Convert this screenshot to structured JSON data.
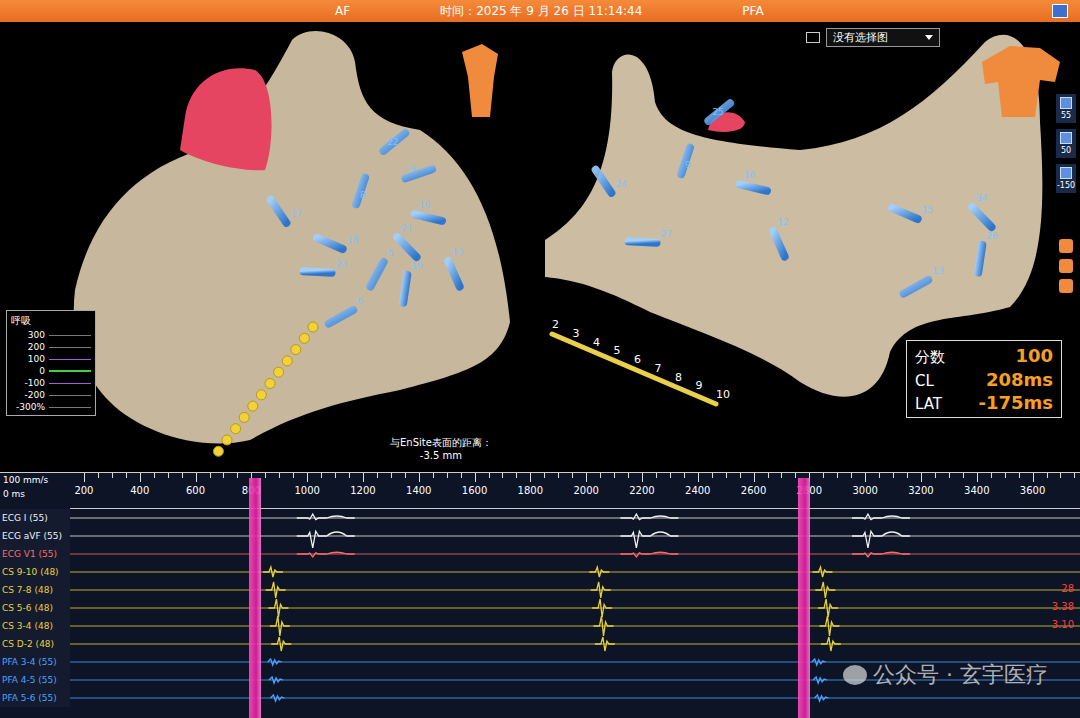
{
  "top_bar": {
    "mode": "AF",
    "time": "时间：2025 年 9 月 26 日 11:14:44",
    "app": "PFA"
  },
  "map_selector": {
    "placeholder": "没有选择图"
  },
  "side_toolbar": {
    "values": [
      "55",
      "50",
      "-150"
    ]
  },
  "respiration": {
    "title": "呼吸",
    "ticks": [
      "300",
      "200",
      "100",
      "0",
      "-100",
      "-200",
      "-300%"
    ]
  },
  "lesions": [
    {
      "view": "left",
      "label": "21"
    },
    {
      "view": "left",
      "label": "23"
    },
    {
      "view": "left",
      "label": "22"
    },
    {
      "view": "left",
      "label": "19"
    },
    {
      "view": "left",
      "label": "17"
    },
    {
      "view": "left",
      "label": "10"
    },
    {
      "view": "left",
      "label": "6"
    },
    {
      "view": "left",
      "label": "8"
    },
    {
      "view": "left",
      "label": "15"
    },
    {
      "view": "left",
      "label": "18"
    },
    {
      "view": "left",
      "label": "9"
    },
    {
      "view": "left",
      "label": "5"
    },
    {
      "view": "right",
      "label": "34"
    },
    {
      "view": "right",
      "label": "27"
    },
    {
      "view": "right",
      "label": "25"
    },
    {
      "view": "right",
      "label": "26"
    },
    {
      "view": "right",
      "label": "24"
    },
    {
      "view": "right",
      "label": "16"
    },
    {
      "view": "right",
      "label": "13"
    },
    {
      "view": "right",
      "label": "9"
    },
    {
      "view": "right",
      "label": "12"
    },
    {
      "view": "right",
      "label": "15"
    }
  ],
  "catheter": {
    "labels": [
      "2",
      "3",
      "4",
      "5",
      "6",
      "7",
      "8",
      "9",
      "10"
    ]
  },
  "distance": {
    "label": "与EnSite表面的距离：",
    "value": "-3.5 mm"
  },
  "stats": [
    {
      "label": "分数",
      "value": "100"
    },
    {
      "label": "CL",
      "value": "208ms"
    },
    {
      "label": "LAT",
      "value": "-175ms"
    }
  ],
  "timeline": {
    "speed": "100 mm/s",
    "origin": "0 ms",
    "ticks": [
      "200",
      "400",
      "600",
      "800",
      "1000",
      "1200",
      "1400",
      "1600",
      "1800",
      "2000",
      "2200",
      "2400",
      "2600",
      "2800",
      "3000",
      "3200",
      "3400",
      "3600"
    ]
  },
  "ablation_marks": [
    790,
    2760
  ],
  "channels": [
    {
      "label": "ECG I (55)",
      "kind": "ecg",
      "color": "#f2f2f2",
      "amp": 4,
      "beats": [
        1020,
        2180,
        3010
      ]
    },
    {
      "label": "ECG aVF (55)",
      "kind": "ecg",
      "color": "#f2f2f2",
      "amp": -12,
      "beats": [
        1020,
        2180,
        3010
      ]
    },
    {
      "label": "ECG V1 (55)",
      "kind": "ecg",
      "color": "#ff6b6b",
      "amp": -3,
      "beats": [
        1020,
        2180,
        3010
      ]
    },
    {
      "label": "CS 9-10 (48)",
      "kind": "cs",
      "color": "#e8d23a",
      "amp": 5,
      "beats": [
        870,
        2040,
        2840
      ]
    },
    {
      "label": "CS 7-8 (48)",
      "kind": "cs",
      "color": "#e8d23a",
      "amp": 8,
      "beats": [
        880,
        2045,
        2850
      ],
      "reading": "28"
    },
    {
      "label": "CS 5-6 (48)",
      "kind": "cs",
      "color": "#e8d23a",
      "amp": 9,
      "beats": [
        890,
        2050,
        2860
      ],
      "reading": "3.38"
    },
    {
      "label": "CS 3-4 (48)",
      "kind": "cs",
      "color": "#e8d23a",
      "amp": 10,
      "beats": [
        895,
        2055,
        2865
      ],
      "reading": "3.10"
    },
    {
      "label": "CS D-2 (48)",
      "kind": "cs",
      "color": "#e8d23a",
      "amp": 7,
      "beats": [
        900,
        2060,
        2870
      ]
    },
    {
      "label": "PFA 3-4 (55)",
      "kind": "pfa",
      "color": "#4aa3ff",
      "amp": 3,
      "beats": [
        880,
        2830
      ]
    },
    {
      "label": "PFA 4-5 (55)",
      "kind": "pfa",
      "color": "#4aa3ff",
      "amp": 3,
      "beats": [
        885,
        2835
      ]
    },
    {
      "label": "PFA 5-6 (55)",
      "kind": "pfa",
      "color": "#4aa3ff",
      "amp": 3,
      "beats": [
        890,
        2840
      ]
    }
  ],
  "watermark": "公众号 · 玄宇医疗"
}
